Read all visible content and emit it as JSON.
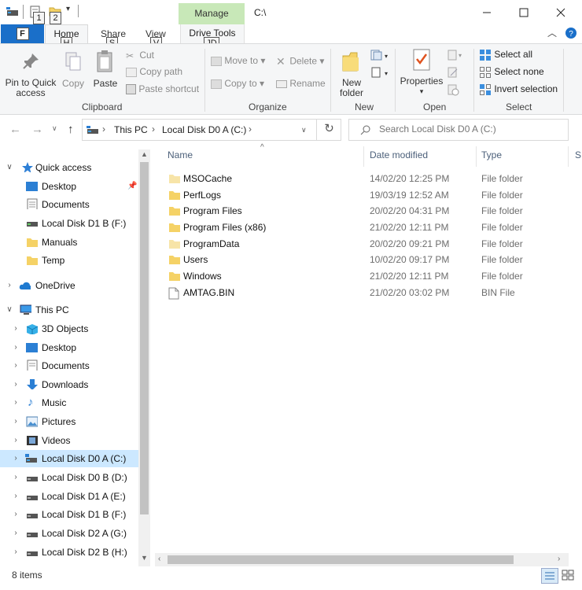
{
  "window": {
    "title": "C:\\",
    "contextual_tab": "Manage",
    "quick_access_keytips": [
      "1",
      "2"
    ]
  },
  "tabs": {
    "file": "F",
    "home": "Home",
    "home_keytip": "H",
    "share": "Share",
    "share_keytip": "S",
    "view": "View",
    "view_keytip": "V",
    "drive_tools": "Drive Tools",
    "drive_tools_keytip": "JD"
  },
  "ribbon": {
    "clipboard": {
      "label": "Clipboard",
      "pin_line1": "Pin to Quick",
      "pin_line2": "access",
      "copy": "Copy",
      "paste": "Paste",
      "cut": "Cut",
      "copy_path": "Copy path",
      "paste_shortcut": "Paste shortcut"
    },
    "organize": {
      "label": "Organize",
      "move_to": "Move to",
      "copy_to": "Copy to",
      "delete": "Delete",
      "rename": "Rename"
    },
    "new": {
      "label": "New",
      "new_folder_line1": "New",
      "new_folder_line2": "folder"
    },
    "open": {
      "label": "Open",
      "properties": "Properties"
    },
    "select": {
      "label": "Select",
      "select_all": "Select all",
      "select_none": "Select none",
      "invert": "Invert selection"
    }
  },
  "address": {
    "crumbs": [
      "This PC",
      "Local Disk D0 A (C:)"
    ],
    "search_placeholder": "Search Local Disk D0 A (C:)"
  },
  "nav": {
    "quick_access": "Quick access",
    "quick_items": [
      "Desktop",
      "Documents",
      "Local Disk D1 B (F:)",
      "Manuals",
      "Temp"
    ],
    "onedrive": "OneDrive",
    "this_pc": "This PC",
    "pc_items": [
      "3D Objects",
      "Desktop",
      "Documents",
      "Downloads",
      "Music",
      "Pictures",
      "Videos",
      "Local Disk D0 A (C:)",
      "Local Disk D0 B (D:)",
      "Local Disk D1 A (E:)",
      "Local Disk D1 B (F:)",
      "Local Disk D2 A (G:)",
      "Local Disk D2 B (H:)"
    ]
  },
  "columns": {
    "name": "Name",
    "date": "Date modified",
    "type": "Type",
    "size": "S"
  },
  "files": [
    {
      "name": "MSOCache",
      "date": "14/02/20 12:25 PM",
      "type": "File folder",
      "icon": "folder-icon-hidden"
    },
    {
      "name": "PerfLogs",
      "date": "19/03/19 12:52 AM",
      "type": "File folder",
      "icon": "folder-icon"
    },
    {
      "name": "Program Files",
      "date": "20/02/20 04:31 PM",
      "type": "File folder",
      "icon": "folder-icon"
    },
    {
      "name": "Program Files (x86)",
      "date": "21/02/20 12:11 PM",
      "type": "File folder",
      "icon": "folder-icon"
    },
    {
      "name": "ProgramData",
      "date": "20/02/20 09:21 PM",
      "type": "File folder",
      "icon": "folder-icon-hidden"
    },
    {
      "name": "Users",
      "date": "10/02/20 09:17 PM",
      "type": "File folder",
      "icon": "folder-icon"
    },
    {
      "name": "Windows",
      "date": "21/02/20 12:11 PM",
      "type": "File folder",
      "icon": "folder-icon"
    },
    {
      "name": "AMTAG.BIN",
      "date": "21/02/20 03:02 PM",
      "type": "BIN File",
      "icon": "file-icon"
    }
  ],
  "status": {
    "item_count": "8 items"
  },
  "colors": {
    "accent": "#1a6fc9",
    "manage_tab": "#c8e8b8",
    "selection": "#cce8ff",
    "folder": "#f5d266"
  }
}
